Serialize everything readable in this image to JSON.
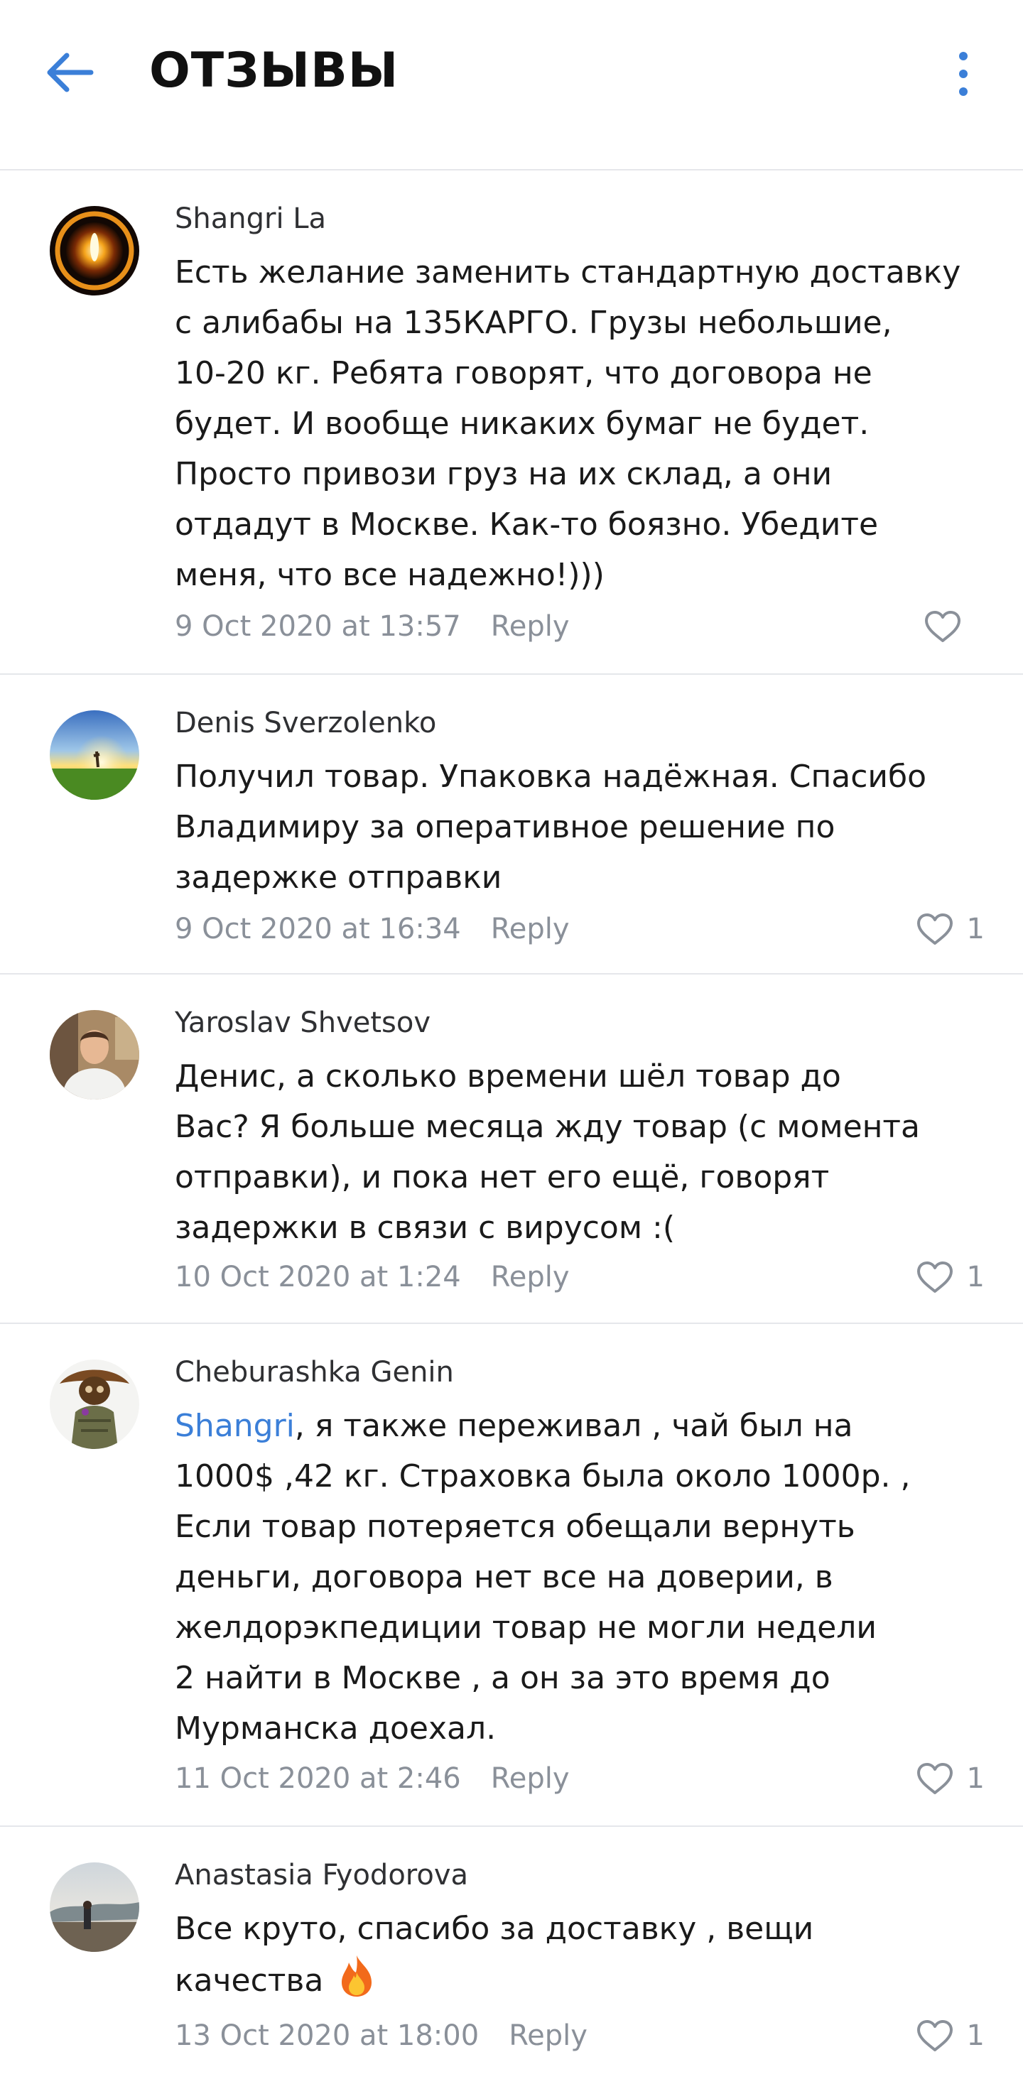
{
  "header": {
    "title": "ОТЗЫВЫ",
    "back_icon": "arrow-left-icon",
    "menu_icon": "more-vertical-icon"
  },
  "colors": {
    "accent": "#3b7fd8",
    "muted": "#8a9099",
    "divider": "#e5e7eb"
  },
  "reply_label": "Reply",
  "comments": [
    {
      "author": "Shangri La",
      "lines": [
        "Есть желание заменить стандартную доставку",
        "с алибабы на 135КАРГО. Грузы небольшие,",
        "10-20 кг. Ребята говорят, что договора не",
        "будет. И вообще никаких бумаг не будет.",
        "Просто привози груз на их склад, а они",
        "отдадут в Москве. Как-то боязно. Убедите",
        "меня, что все надежно!)))"
      ],
      "date": "9 Oct 2020 at 13:57",
      "likes": ""
    },
    {
      "author": "Denis Sverzolenko",
      "lines": [
        "Получил товар. Упаковка надёжная. Спасибо",
        "Владимиру за оперативное решение по",
        "задержке отправки"
      ],
      "date": "9 Oct 2020 at 16:34",
      "likes": "1"
    },
    {
      "author": "Yaroslav Shvetsov",
      "lines": [
        "Денис, а сколько времени шёл товар до",
        "Вас? Я больше месяца жду товар (с момента",
        "отправки), и пока нет его ещё, говорят",
        "задержки в связи с вирусом :("
      ],
      "date": "10 Oct 2020 at 1:24",
      "likes": "1"
    },
    {
      "author": "Cheburashka Genin",
      "mention": "Shangri",
      "first_line_rest": ", я также переживал , чай был на",
      "lines": [
        "1000$ ,42 кг.  Страховка была около 1000р. ,",
        "Если товар потеряется обещали вернуть",
        "деньги, договора нет все на доверии, в",
        "желдорэкпедиции товар не могли недели",
        "2 найти в Москве , а он за это время до",
        "Мурманска доехал."
      ],
      "date": "11 Oct 2020 at 2:46",
      "likes": "1"
    },
    {
      "author": "Anastasia Fyodorova",
      "lines": [
        "Все круто, спасибо за доставку , вещи",
        "качества"
      ],
      "emoji": "fire-emoji-icon",
      "date": "13 Oct 2020 at 18:00",
      "likes": "1"
    }
  ]
}
